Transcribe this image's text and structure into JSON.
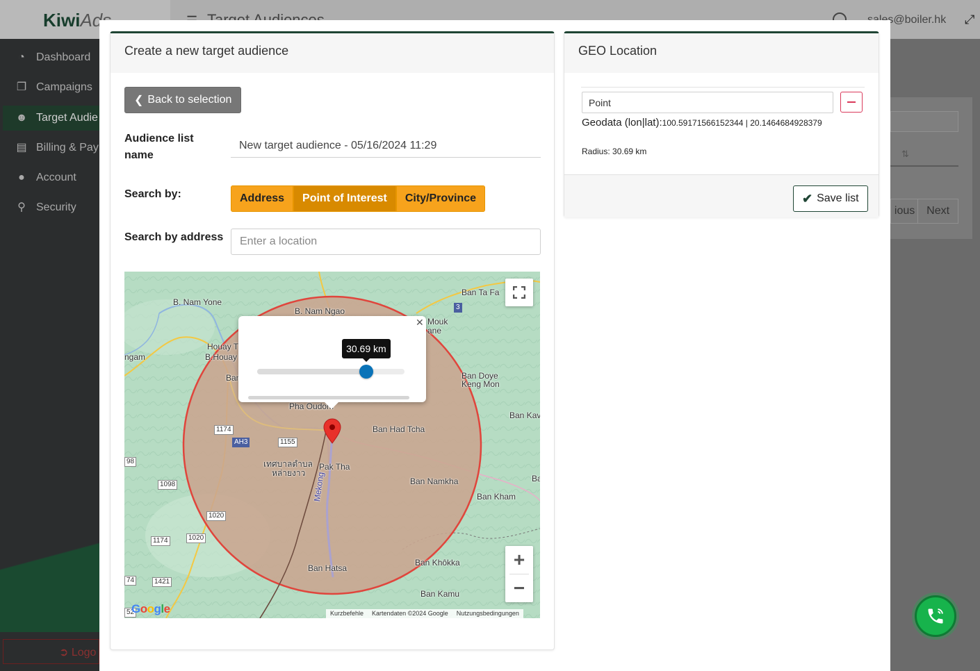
{
  "background": {
    "brand": "Kiwi",
    "brand_suffix": "Ads",
    "header_title": "Target Audiences",
    "user_email": "sales@boiler.hk",
    "nav": [
      {
        "label": "Dashboard",
        "icon": "pie-chart-icon"
      },
      {
        "label": "Campaigns",
        "icon": "files-icon"
      },
      {
        "label": "Target Audie",
        "icon": "users-icon"
      },
      {
        "label": "Billing & Pay",
        "icon": "credit-card-icon"
      },
      {
        "label": "Account",
        "icon": "user-icon"
      },
      {
        "label": "Security",
        "icon": "key-icon"
      }
    ],
    "logout_label": "Logo",
    "pager_prev": "ious",
    "pager_next": "Next",
    "sort_glyph": "⇅"
  },
  "create_card": {
    "title": "Create a new target audience",
    "back_label": "Back to selection",
    "name_label": "Audience list name",
    "name_value": "New target audience - 05/16/2024 11:29",
    "search_by_label": "Search by:",
    "search_options": [
      "Address",
      "Point of Interest",
      "City/Province"
    ],
    "selected_option": "Point of Interest",
    "address_label": "Search by address",
    "address_placeholder": "Enter a location"
  },
  "map": {
    "places": [
      {
        "name": "B. Nam Yone"
      },
      {
        "name": "B. Nam Ngao"
      },
      {
        "name": "Ban Ta Fa"
      },
      {
        "name": "Mouk"
      },
      {
        "name": "ane"
      },
      {
        "name": "Houay T"
      },
      {
        "name": "B.Houay"
      },
      {
        "name": "ngam"
      },
      {
        "name": "Ban"
      },
      {
        "name": "Ban Doye"
      },
      {
        "name": "Keng Mon"
      },
      {
        "name": "Pha Oudom"
      },
      {
        "name": "Ban Kav"
      },
      {
        "name": "Ban Had Tcha"
      },
      {
        "name": "เทศบาลตำบล"
      },
      {
        "name": "หล่ายงาว"
      },
      {
        "name": "Pak Tha"
      },
      {
        "name": "Ban Namkha"
      },
      {
        "name": "Ba"
      },
      {
        "name": "Ban Kham"
      },
      {
        "name": "Mekong"
      },
      {
        "name": "Ban Khôkka"
      },
      {
        "name": "Ban Hatsa"
      },
      {
        "name": "Ban Kamu"
      }
    ],
    "road_badges": [
      {
        "label": "3",
        "style": "blue"
      },
      {
        "label": "1174",
        "style": "white"
      },
      {
        "label": "AH3",
        "style": "blue"
      },
      {
        "label": "1155",
        "style": "white"
      },
      {
        "label": "98",
        "style": "white"
      },
      {
        "label": "1098",
        "style": "white"
      },
      {
        "label": "1020",
        "style": "white"
      },
      {
        "label": "1174",
        "style": "white"
      },
      {
        "label": "1020",
        "style": "white"
      },
      {
        "label": "74",
        "style": "white"
      },
      {
        "label": "1421",
        "style": "white"
      },
      {
        "label": "52",
        "style": "white"
      }
    ],
    "google": "Google",
    "attrib": [
      "Kurzbefehle",
      "Kartendaten ©2024 Google",
      "Nutzungsbedingungen"
    ],
    "radius_tooltip": "30.69 km",
    "radius_slider_fraction": 0.74,
    "circle_fill": "#c9a58f",
    "circle_stroke": "#e0453c",
    "marker_color": "#e8312a"
  },
  "geo_card": {
    "title": "GEO Location",
    "point_value": "Point",
    "geodata_label": "Geodata (lon|lat):",
    "geodata_value": "100.59171566152344 | 20.1464684928379",
    "radius_text": "Radius: 30.69 km",
    "save_label": "Save list"
  },
  "colors": {
    "brand_green": "#1f4534",
    "orange": "#f7a31c",
    "orange_active": "#d88a00",
    "danger": "#d9395a",
    "call_green": "#17b34c"
  }
}
